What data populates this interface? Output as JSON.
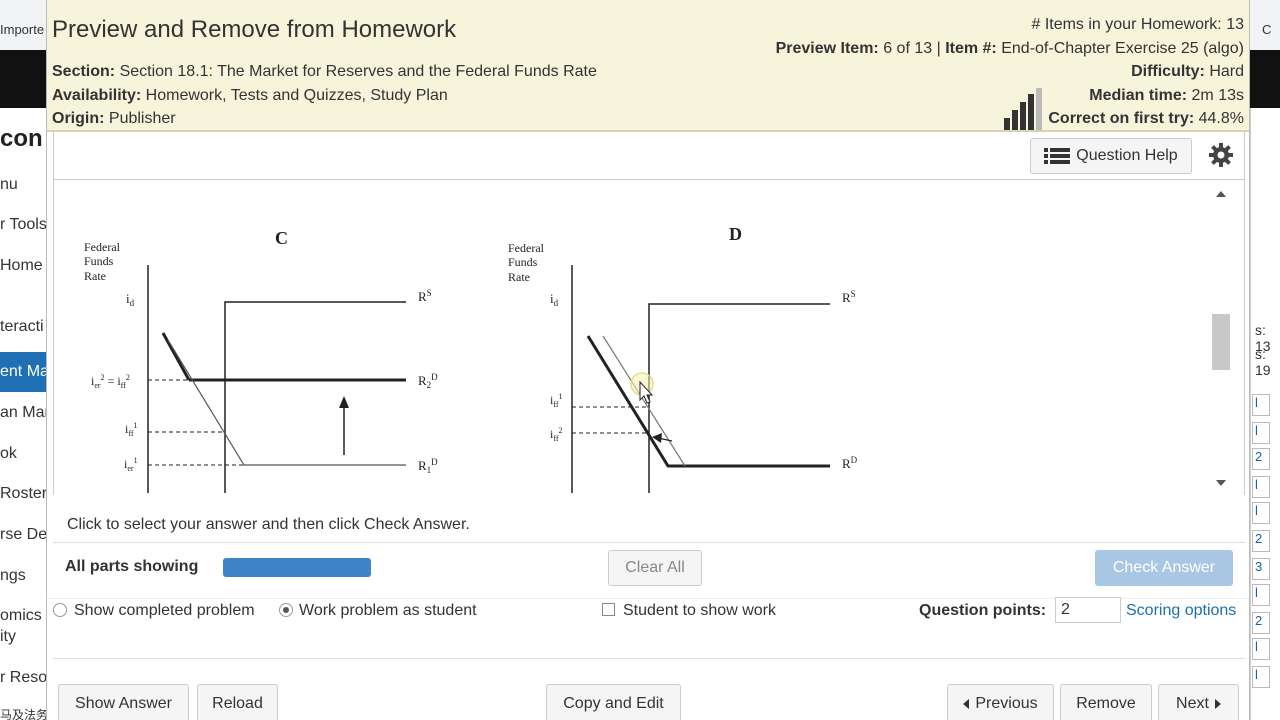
{
  "background": {
    "bookmark_left": "Importe",
    "bookmark_right": "C",
    "left_title": "con",
    "left_items": [
      "nu",
      "r Tools",
      "Home",
      "teracti",
      "ent Ma",
      "an Mar",
      "ok",
      "Roster",
      "rse De",
      "ngs",
      "omics",
      "ity",
      "r Reso",
      "马及法务"
    ],
    "right_marks": [
      "s: 13",
      "s: 19"
    ],
    "right_cells": [
      "l",
      "l",
      "2",
      "l",
      "l",
      "2",
      "3",
      "l",
      "2",
      "l",
      "l"
    ]
  },
  "modal": {
    "title": "Preview and Remove from Homework",
    "section_label": "Section:",
    "section_value": "Section 18.1: The Market for Reserves and the Federal Funds Rate",
    "availability_label": "Availability:",
    "availability_value": "Homework, Tests and Quizzes, Study Plan",
    "origin_label": "Origin:",
    "origin_value": "Publisher",
    "items_count_text": "# Items in your Homework: 13",
    "preview_item_label": "Preview Item:",
    "preview_item_value": "6 of 13 |",
    "item_num_label": "Item #:",
    "item_num_value": "End-of-Chapter Exercise 25 (algo)",
    "difficulty_label": "Difficulty:",
    "difficulty_value": "Hard",
    "median_label": "Median time:",
    "median_value": "2m 13s",
    "correct_label": "Correct on first try:",
    "correct_value": "44.8%"
  },
  "toolbar": {
    "question_help": "Question Help"
  },
  "graphs": {
    "c": {
      "panel_label": "C",
      "y_title_1": "Federal",
      "y_title_2": "Funds",
      "y_title_3": "Rate",
      "id_label": "i",
      "id_sub": "d",
      "ier2_label": "i",
      "ier2_sub": "er",
      "ier2_sup": "2",
      "eq": " = i",
      "iff2_sub": "ff",
      "iff2_sup": "2",
      "iff1_label": "i",
      "iff1_sub": "ff",
      "iff1_sup": "1",
      "ier1_label": "i",
      "ier1_sub": "er",
      "ier1_sup": "1",
      "rs_label": "R",
      "rs_sup": "S",
      "r2d_label": "R",
      "r2d_sub": "2",
      "r2d_sup": "D",
      "r1d_label": "R",
      "r1d_sub": "1",
      "r1d_sup": "D"
    },
    "d": {
      "panel_label": "D",
      "y_title_1": "Federal",
      "y_title_2": "Funds",
      "y_title_3": "Rate",
      "id_label": "i",
      "id_sub": "d",
      "iff1_label": "i",
      "iff1_sub": "ff",
      "iff1_sup": "1",
      "iff2_label": "i",
      "iff2_sub": "ff",
      "iff2_sup": "2",
      "rs_label": "R",
      "rs_sup": "S",
      "rd_label": "R",
      "rd_sup": "D"
    }
  },
  "instruction": "Click to select your answer and then click Check Answer.",
  "parts_label": "All parts showing",
  "progress_fraction": 1.0,
  "clear_all": "Clear All",
  "check_answer": "Check Answer",
  "options": {
    "show_completed": "Show completed problem",
    "work_as_student": "Work problem as student",
    "student_show_work": "Student to show work",
    "selected_mode": "work_as_student"
  },
  "question_points_label": "Question points:",
  "question_points_value": "2",
  "scoring_options": "Scoring options",
  "footer": {
    "show_answer": "Show Answer",
    "reload": "Reload",
    "copy_edit": "Copy and Edit",
    "previous": "Previous",
    "remove": "Remove",
    "next": "Next"
  },
  "colors": {
    "header_bg": "#f7f4dc",
    "progress": "#3f84c9",
    "check_button": "#a7c7e5",
    "link": "#1a6fb0"
  }
}
